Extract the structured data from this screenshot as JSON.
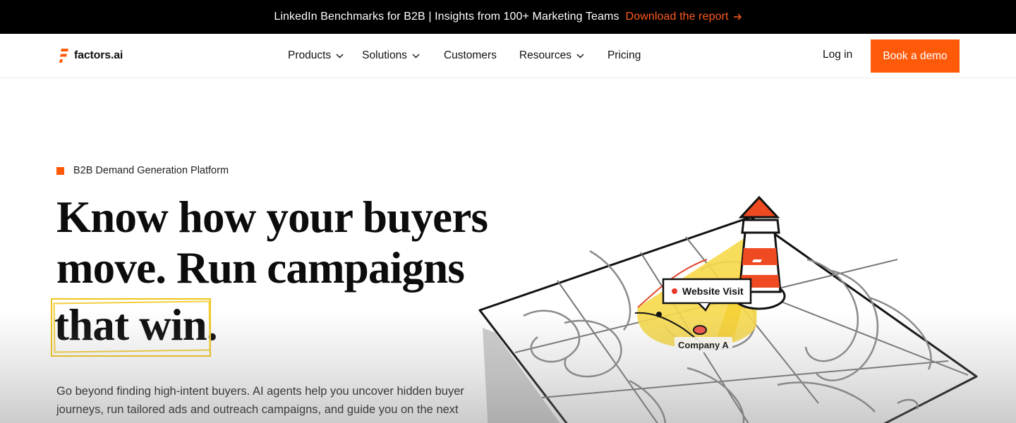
{
  "announcement": {
    "message": "LinkedIn Benchmarks for B2B | Insights from 100+ Marketing Teams",
    "link_label": "Download the report",
    "link_color": "#ff5a1f"
  },
  "brand": {
    "name": "factors.ai",
    "icon": "factors-logo-icon",
    "accent_color": "#ff5a0a"
  },
  "nav": {
    "items": [
      {
        "label": "Products",
        "has_dropdown": true
      },
      {
        "label": "Solutions",
        "has_dropdown": true
      },
      {
        "label": "Customers",
        "has_dropdown": false
      },
      {
        "label": "Resources",
        "has_dropdown": true
      },
      {
        "label": "Pricing",
        "has_dropdown": false
      }
    ],
    "login_label": "Log in",
    "cta_label": "Book a demo"
  },
  "hero": {
    "eyebrow": "B2B Demand Generation Platform",
    "headline_line1": "Know how your buyers",
    "headline_line2": "move. Run campaigns",
    "headline_line3": "that win.",
    "subtext": "Go beyond finding high-intent buyers. AI agents help you uncover hidden buyer journeys, run tailored ads and outreach campaigns, and guide you on the next",
    "highlight_color": "#f0c419"
  },
  "illustration": {
    "tooltip_label": "Website Visit",
    "marker_label": "Company A",
    "icons": [
      "lighthouse-icon",
      "map-icon"
    ]
  }
}
